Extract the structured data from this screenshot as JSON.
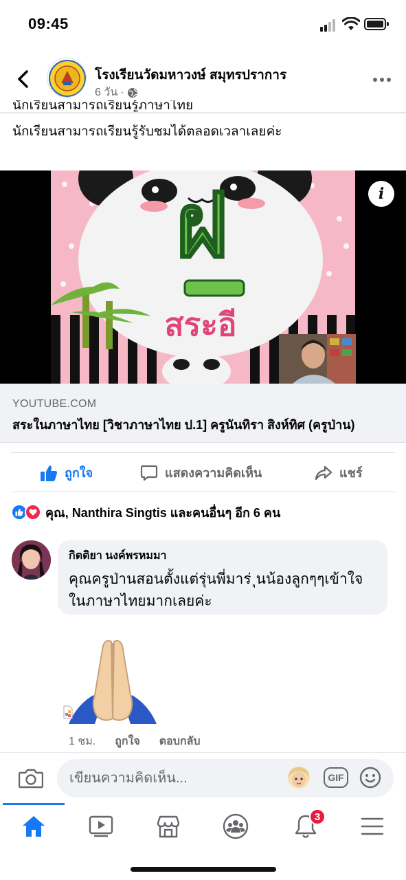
{
  "status_bar": {
    "time": "09:45"
  },
  "post": {
    "page_name": "โรงเรียนวัดมหาวงษ์ สมุทรปราการ",
    "time_ago": "6 วัน",
    "meta_separator": "·",
    "cut_off_text": "นักเรียนสามารถเรียนรู้ภาษาไทย",
    "text": "นักเรียนสามารถเรียนรู้รับชมได้ตลอดเวลาเลยค่ะ"
  },
  "video": {
    "thumbnail_text_big": "ฝ",
    "thumbnail_text_small": "สระอี",
    "info_label": "i"
  },
  "link": {
    "domain": "YOUTUBE.COM",
    "title": "สระในภาษาไทย [วิชาภาษาไทย ป.1] ครูนันทิรา สิงห์ทิศ (ครูป่าน)"
  },
  "actions": {
    "like": "ถูกใจ",
    "comment": "แสดงความคิดเห็น",
    "share": "แชร์"
  },
  "reactions": {
    "summary": "คุณ, Nanthira Singtis และคนอื่นๆ อีก 6 คน"
  },
  "comment": {
    "author": "กิตติยา นงค์พรหมมา",
    "text_line1": "คุณครูป่านสอนตั้งแต่รุ่นพี่มาร่ ุนน้องลูกๆๆเข้าใจ",
    "text_line2": "ในภาษาไทยมากเลยค่ะ",
    "time": "1 ชม.",
    "like_label": "ถูกใจ",
    "reply_label": "ตอบกลับ"
  },
  "composer": {
    "placeholder": "เขียนความคิดเห็น...",
    "gif_label": "GIF"
  },
  "tabs": [
    {
      "name": "home",
      "active": true
    },
    {
      "name": "watch",
      "active": false
    },
    {
      "name": "marketplace",
      "active": false
    },
    {
      "name": "groups",
      "active": false
    },
    {
      "name": "notifications",
      "active": false,
      "badge": "3"
    },
    {
      "name": "menu",
      "active": false
    }
  ],
  "colors": {
    "accent": "#1877f2",
    "secondary_text": "#65676b",
    "bubble_bg": "#f0f2f5",
    "badge": "#e41e3f",
    "love": "#f0284a"
  },
  "icons": [
    "back-icon",
    "globe-icon",
    "more-icon",
    "info-icon",
    "like-icon",
    "comment-icon",
    "share-icon",
    "camera-icon",
    "gif-icon",
    "smile-icon",
    "home-icon",
    "watch-icon",
    "marketplace-icon",
    "groups-icon",
    "bell-icon",
    "menu-icon"
  ]
}
